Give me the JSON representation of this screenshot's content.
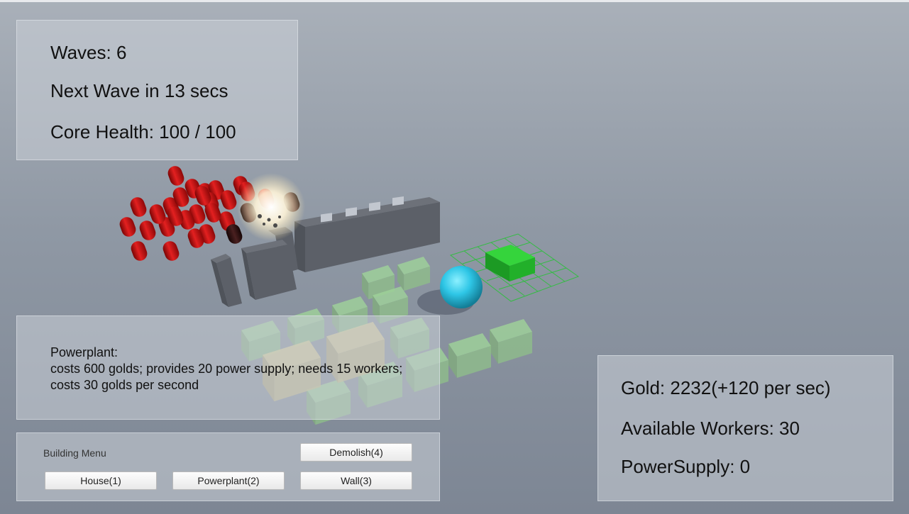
{
  "status": {
    "waves": "Waves: 6",
    "next_wave": "Next Wave in 13 secs",
    "core_health": "Core Health: 100 / 100"
  },
  "info": {
    "title": "Powerplant:",
    "description": "costs 600 golds; provides 20 power supply; needs 15 workers; costs 30 golds per second"
  },
  "building_menu": {
    "title": "Building Menu",
    "demolish_label": "Demolish(4)",
    "house_label": "House(1)",
    "powerplant_label": "Powerplant(2)",
    "wall_label": "Wall(3)"
  },
  "resources": {
    "gold": "Gold: 2232(+120 per sec)",
    "workers": "Available Workers: 30",
    "power": "PowerSupply: 0"
  },
  "colors": {
    "enemy": "#c81414",
    "core": "#2ec6e6",
    "placement_preview": "#1fb02a",
    "wall": "#5c6068",
    "house": "#9fd29a",
    "powerplant": "#d8cc96"
  }
}
